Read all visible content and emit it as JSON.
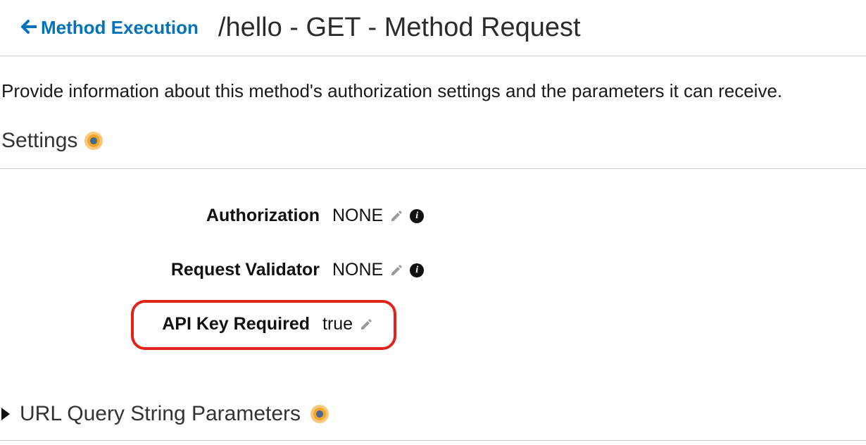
{
  "header": {
    "back_label": "Method Execution",
    "title": "/hello - GET - Method Request"
  },
  "description": "Provide information about this method's authorization settings and the parameters it can receive.",
  "sections": {
    "settings": {
      "title": "Settings",
      "fields": {
        "authorization": {
          "label": "Authorization",
          "value": "NONE"
        },
        "request_validator": {
          "label": "Request Validator",
          "value": "NONE"
        },
        "api_key_required": {
          "label": "API Key Required",
          "value": "true"
        }
      }
    },
    "url_query_params": {
      "title": "URL Query String Parameters"
    }
  }
}
